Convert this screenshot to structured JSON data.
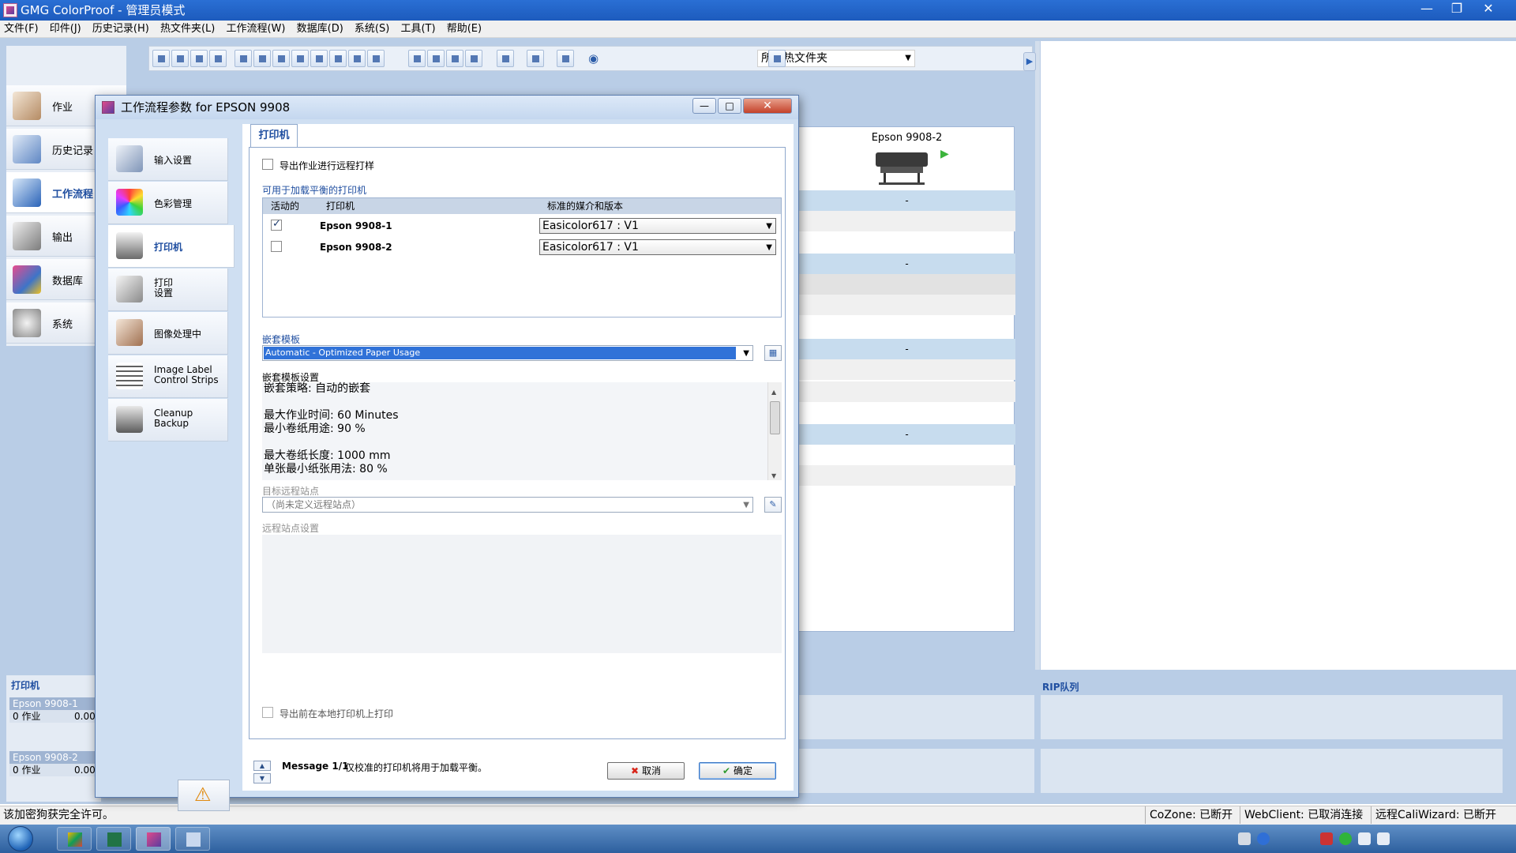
{
  "window": {
    "title": "GMG ColorProof - 管理员模式"
  },
  "menu": [
    "文件(F)",
    "印件(J)",
    "历史记录(H)",
    "热文件夹(L)",
    "工作流程(W)",
    "数据库(D)",
    "系统(S)",
    "工具(T)",
    "帮助(E)"
  ],
  "leftnav": {
    "items": [
      {
        "label": "作业",
        "active": false
      },
      {
        "label": "历史记录",
        "active": false
      },
      {
        "label": "工作流程",
        "active": true
      },
      {
        "label": "输出",
        "active": false
      },
      {
        "label": "数据库",
        "active": false
      },
      {
        "label": "系统",
        "active": false
      }
    ]
  },
  "toolbar": {
    "hotfolder_filter": "所有热文件夹"
  },
  "right_panel": {
    "printer_name": "Epson 9908-2",
    "row_values": [
      "-",
      "-",
      "-",
      "-"
    ]
  },
  "bottom": {
    "printers_header": "打印机",
    "printers": [
      {
        "name": "Epson 9908-1",
        "jobs": "0 作业",
        "val": "0.00"
      },
      {
        "name": "Epson 9908-2",
        "jobs": "0 作业",
        "val": "0.00"
      }
    ],
    "rip_header": "RIP队列"
  },
  "statusbar": {
    "left": "该加密狗获完全许可。",
    "cozone": "CoZone: 已断开",
    "webclient": "WebClient: 已取消连接",
    "caliwizard": "远程CaliWizard: 已断开"
  },
  "dialog": {
    "title": "工作流程参数 for EPSON 9908",
    "nav": [
      {
        "label": "输入设置"
      },
      {
        "label": "色彩管理"
      },
      {
        "label": "打印机",
        "active": true
      },
      {
        "label": "打印\n设置"
      },
      {
        "label": "图像处理中"
      },
      {
        "label": "Image Label\nControl Strips"
      },
      {
        "label": "Cleanup\nBackup"
      }
    ],
    "tab": "打印机",
    "export_remote_proof": "导出作业进行远程打样",
    "loadbalance_label": "可用于加载平衡的打印机",
    "table": {
      "headers": [
        "活动的",
        "打印机",
        "标准的媒介和版本"
      ],
      "rows": [
        {
          "active": true,
          "printer": "Epson 9908-1",
          "media": "Easicolor617 : V1"
        },
        {
          "active": false,
          "printer": "Epson 9908-2",
          "media": "Easicolor617 : V1"
        }
      ]
    },
    "nesting_template_label": "嵌套模板",
    "nesting_template_value": "Automatic - Optimized Paper Usage",
    "nesting_settings_label": "嵌套模板设置",
    "nesting_settings": [
      "嵌套策略: 自动的嵌套",
      "",
      "最大作业时间: 60 Minutes",
      "最小卷纸用途: 90 %",
      "",
      "最大卷纸长度: 1000 mm",
      "单张最小纸张用法: 80 %"
    ],
    "remote_site_label": "目标远程站点",
    "remote_site_value": "（尚未定义远程站点）",
    "remote_settings_label": "远程站点设置",
    "print_local_label": "导出前在本地打印机上打印",
    "message_count": "Message 1/1",
    "message_text": "仅校准的打印机将用于加载平衡。",
    "cancel_label": "取消",
    "ok_label": "确定"
  }
}
